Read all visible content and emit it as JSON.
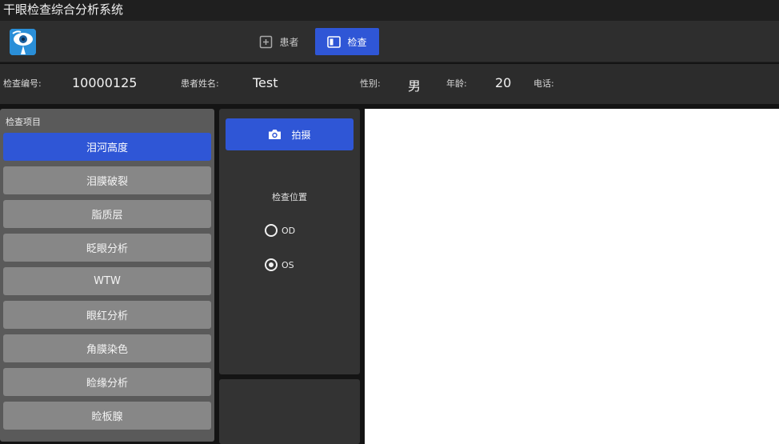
{
  "app": {
    "title": "干眼检查综合分析系统"
  },
  "nav": {
    "tabs": [
      {
        "label": "患者",
        "icon": "plus-square-icon",
        "active": false
      },
      {
        "label": "检查",
        "icon": "film-panel-icon",
        "active": true
      }
    ]
  },
  "info": {
    "exam_id_label": "检查编号:",
    "exam_id": "10000125",
    "patient_name_label": "患者姓名:",
    "patient_name": "Test",
    "gender_label": "性别:",
    "gender": "男",
    "age_label": "年龄:",
    "age": "20",
    "phone_label": "电话:",
    "phone": ""
  },
  "exam_items": {
    "heading": "检查项目",
    "items": [
      {
        "label": "泪河高度",
        "active": true
      },
      {
        "label": "泪膜破裂",
        "active": false
      },
      {
        "label": "脂质层",
        "active": false
      },
      {
        "label": "眨眼分析",
        "active": false
      },
      {
        "label": "WTW",
        "active": false
      },
      {
        "label": "眼红分析",
        "active": false
      },
      {
        "label": "角膜染色",
        "active": false
      },
      {
        "label": "睑缘分析",
        "active": false
      },
      {
        "label": "睑板腺",
        "active": false
      }
    ]
  },
  "capture": {
    "button_label": "拍摄",
    "position_label": "检查位置",
    "options": [
      {
        "label": "OD",
        "checked": false
      },
      {
        "label": "OS",
        "checked": true
      }
    ]
  },
  "colors": {
    "accent": "#2f56d6",
    "item_button": "#878787",
    "panel": "#333333"
  }
}
